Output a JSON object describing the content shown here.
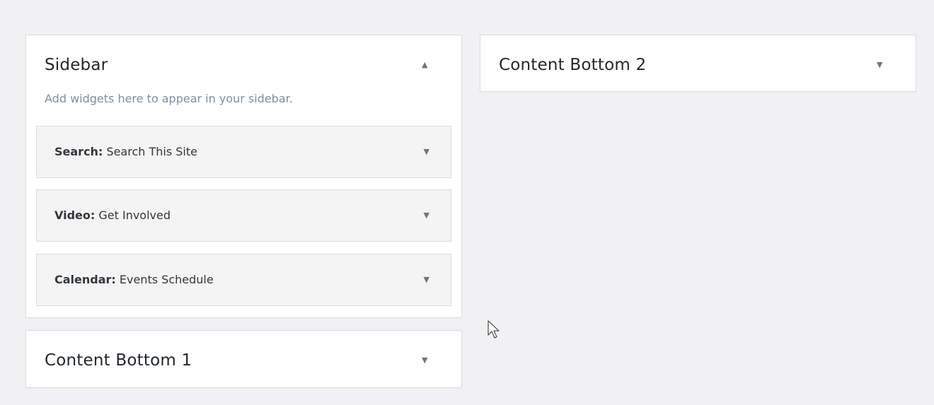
{
  "sidebar": {
    "title": "Sidebar",
    "description": "Add widgets here to appear in your sidebar.",
    "toggle": "▲",
    "widgets": [
      {
        "name": "Search:",
        "title": " Search This Site",
        "toggle": "▼"
      },
      {
        "name": "Video:",
        "title": " Get Involved",
        "toggle": "▼"
      },
      {
        "name": "Calendar:",
        "title": " Events Schedule",
        "toggle": "▼"
      }
    ]
  },
  "content_bottom_1": {
    "title": "Content Bottom 1",
    "toggle": "▼"
  },
  "content_bottom_2": {
    "title": "Content Bottom 2",
    "toggle": "▼"
  },
  "cursor_icon": "arrow-cursor-icon"
}
